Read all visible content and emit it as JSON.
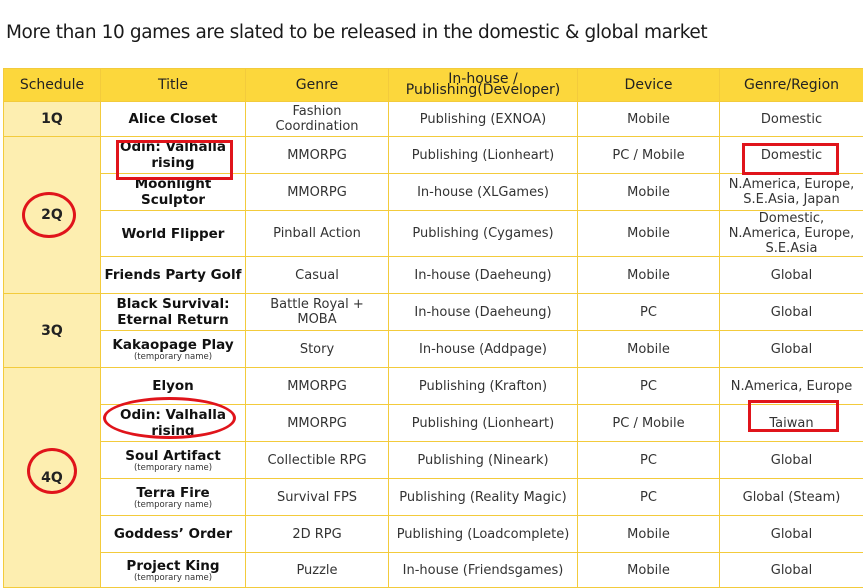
{
  "heading": "More than 10 games are slated to be released in the domestic & global market",
  "columns": {
    "schedule": "Schedule",
    "title": "Title",
    "genre": "Genre",
    "developer": "In-house / Publishing(Developer)",
    "device": "Device",
    "region": "Genre/Region"
  },
  "quarters": [
    "1Q",
    "2Q",
    "3Q",
    "4Q"
  ],
  "games": [
    {
      "title": "Alice Closet",
      "sub": "",
      "genre": "Fashion Coordination",
      "developer": "Publishing (EXNOA)",
      "device": "Mobile",
      "region": "Domestic"
    },
    {
      "title": "Odin: Valhalla rising",
      "sub": "",
      "genre": "MMORPG",
      "developer": "Publishing (Lionheart)",
      "device": "PC / Mobile",
      "region": "Domestic"
    },
    {
      "title": "Moonlight Sculptor",
      "sub": "",
      "genre": "MMORPG",
      "developer": "In-house (XLGames)",
      "device": "Mobile",
      "region": "N.America, Europe, S.E.Asia, Japan"
    },
    {
      "title": "World Flipper",
      "sub": "",
      "genre": "Pinball Action",
      "developer": "Publishing (Cygames)",
      "device": "Mobile",
      "region": "Domestic, N.America, Europe, S.E.Asia"
    },
    {
      "title": "Friends Party Golf",
      "sub": "",
      "genre": "Casual",
      "developer": "In-house (Daeheung)",
      "device": "Mobile",
      "region": "Global"
    },
    {
      "title": "Black Survival: Eternal Return",
      "sub": "",
      "genre": "Battle Royal + MOBA",
      "developer": "In-house (Daeheung)",
      "device": "PC",
      "region": "Global"
    },
    {
      "title": "Kakaopage Play",
      "sub": "(temporary name)",
      "genre": "Story",
      "developer": "In-house (Addpage)",
      "device": "Mobile",
      "region": "Global"
    },
    {
      "title": "Elyon",
      "sub": "",
      "genre": "MMORPG",
      "developer": "Publishing (Krafton)",
      "device": "PC",
      "region": "N.America, Europe"
    },
    {
      "title": "Odin: Valhalla rising",
      "sub": "",
      "genre": "MMORPG",
      "developer": "Publishing (Lionheart)",
      "device": "PC / Mobile",
      "region": "Taiwan"
    },
    {
      "title": "Soul Artifact",
      "sub": "(temporary name)",
      "genre": "Collectible RPG",
      "developer": "Publishing (Nineark)",
      "device": "PC",
      "region": "Global"
    },
    {
      "title": "Terra Fire",
      "sub": "(temporary name)",
      "genre": "Survival FPS",
      "developer": "Publishing (Reality Magic)",
      "device": "PC",
      "region": "Global (Steam)"
    },
    {
      "title": "Goddess’ Order",
      "sub": "",
      "genre": "2D RPG",
      "developer": "Publishing (Loadcomplete)",
      "device": "Mobile",
      "region": "Global"
    },
    {
      "title": "Project King",
      "sub": "(temporary name)",
      "genre": "Puzzle",
      "developer": "In-house (Friendsgames)",
      "device": "Mobile",
      "region": "Global"
    }
  ],
  "annotation_color": "#e0141b",
  "header_color": "#fcd73c",
  "quarter_cell_color": "#fdeeb0"
}
